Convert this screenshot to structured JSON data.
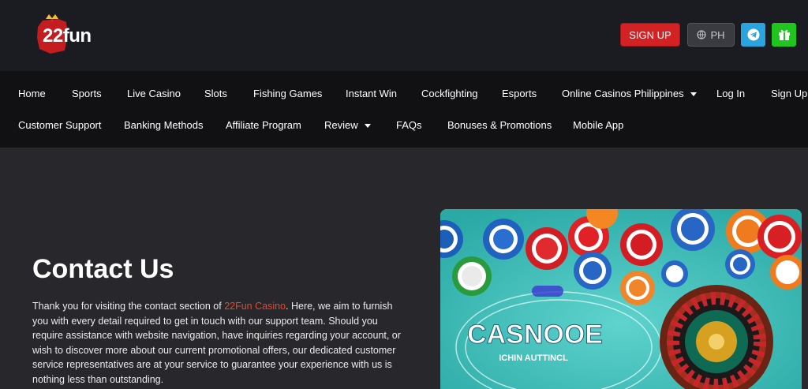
{
  "brand": {
    "logo_text": "22fun",
    "logo_number": "22",
    "logo_word": "fun"
  },
  "header": {
    "signup_label": "SIGN UP",
    "lang_label": "PH",
    "telegram_icon": "telegram-icon",
    "gift_icon": "gift-icon"
  },
  "nav": {
    "row1": [
      "Home",
      "Sports",
      "Live Casino",
      "Slots",
      "Fishing Games",
      "Instant Win",
      "Cockfighting",
      "Esports",
      "Online Casinos Philippines",
      "Log In",
      "Sign Up"
    ],
    "row2": [
      "Customer Support",
      "Banking Methods",
      "Affiliate Program",
      "Review",
      "FAQs",
      "Bonuses & Promotions",
      "Mobile App"
    ]
  },
  "content": {
    "title": "Contact Us",
    "intro_before": "Thank you for visiting the contact section of ",
    "intro_link": "22Fun Casino",
    "intro_after": ". Here, we aim to furnish you with every detail required to get in touch with our support team. Should you require assistance with website navigation, have inquiries regarding your account, or wish to discover more about our current promotional offers, our dedicated customer service representatives are at your service to guarantee your experience with us is nothing less than outstanding."
  },
  "hero": {
    "headline": "CASNOOE",
    "subline": "ICHIN AUTTINCL"
  },
  "colors": {
    "accent_red": "#d32223",
    "link": "#e04a2f",
    "telegram": "#2aa3de",
    "gift": "#20c51e"
  }
}
